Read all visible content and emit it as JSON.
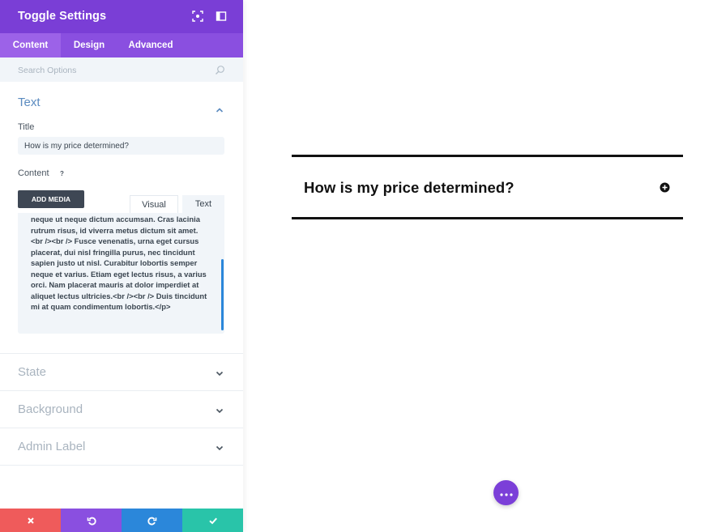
{
  "header": {
    "title": "Toggle Settings",
    "icons": [
      "focus-icon",
      "sidebar-layout-icon"
    ],
    "bg_color": "#7a3ed6"
  },
  "tabs": [
    {
      "label": "Content",
      "active": true
    },
    {
      "label": "Design",
      "active": false
    },
    {
      "label": "Advanced",
      "active": false
    }
  ],
  "search": {
    "placeholder": "Search Options"
  },
  "sections": {
    "text": {
      "label": "Text",
      "expanded": true,
      "title_label": "Title",
      "title_value": "How is my price determined?",
      "content_label": "Content",
      "help_glyph": "?",
      "add_media_label": "ADD MEDIA",
      "editor_tabs": [
        "Visual",
        "Text"
      ],
      "content_value": "neque ut neque dictum accumsan. Cras lacinia rutrum risus, id viverra metus dictum sit amet. <br /><br /> Fusce venenatis, urna eget cursus placerat, dui nisl fringilla purus, nec tincidunt sapien justo ut nisl. Curabitur lobortis semper neque et varius. Etiam eget lectus risus, a varius orci. Nam placerat mauris at dolor imperdiet at aliquet lectus ultricies.<br /><br /> Duis tincidunt mi at quam condimentum lobortis.</p>"
    },
    "state": {
      "label": "State",
      "expanded": false
    },
    "background": {
      "label": "Background",
      "expanded": false
    },
    "admin_label": {
      "label": "Admin Label",
      "expanded": false
    }
  },
  "footer": {
    "buttons": [
      {
        "name": "discard",
        "icon": "close-icon",
        "color": "#ef5b5b"
      },
      {
        "name": "undo",
        "icon": "undo-icon",
        "color": "#8a4fe0"
      },
      {
        "name": "redo",
        "icon": "redo-icon",
        "color": "#2b87da"
      },
      {
        "name": "save",
        "icon": "check-icon",
        "color": "#29c4a9"
      }
    ]
  },
  "preview": {
    "toggle_title": "How is my price determined?",
    "toggle_icon": "plus-circle-icon",
    "fab_icon": "more-dots-icon",
    "fab_color": "#7b3fd8"
  },
  "colors": {
    "accent_purple": "#7a3ed6",
    "section_blue": "#5b8bc0",
    "muted_gray": "#a9b4bf"
  }
}
